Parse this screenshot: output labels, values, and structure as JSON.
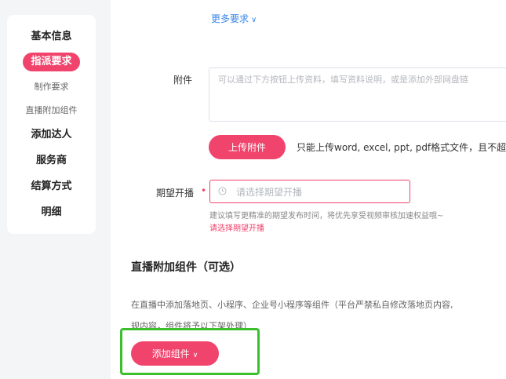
{
  "sidebar": {
    "items": [
      {
        "label": "基本信息"
      },
      {
        "label": "指派要求"
      },
      {
        "label": "制作要求"
      },
      {
        "label": "直播附加组件"
      },
      {
        "label": "添加达人"
      },
      {
        "label": "服务商"
      },
      {
        "label": "结算方式"
      },
      {
        "label": "明细"
      }
    ],
    "active_index": 1
  },
  "form": {
    "more_requirements_link": "更多要求",
    "attachment": {
      "label": "附件",
      "placeholder": "可以通过下方按钮上传资料，填写资料说明，或是添加外部网盘链"
    },
    "upload_button_label": "上传附件",
    "upload_hint": "只能上传word, excel, ppt, pdf格式文件，且不超",
    "expected_start": {
      "label": "期望开播",
      "required_mark": "•",
      "placeholder": "请选择期望开播",
      "hint": "建议填写更精准的期望发布时间，将优先享受视频审核加速权益哦~",
      "error": "请选择期望开播"
    }
  },
  "components_section": {
    "title": "直播附加组件（可选）",
    "description_line1": "在直播中添加落地页、小程序、企业号小程序等组件（平台严禁私自修改落地页内容,",
    "description_line2": "规内容，组件将予以下架处理）",
    "add_button_label": "添加组件"
  },
  "colors": {
    "accent": "#f1446d",
    "link": "#3a86ea",
    "highlight": "#3bbf2d"
  }
}
